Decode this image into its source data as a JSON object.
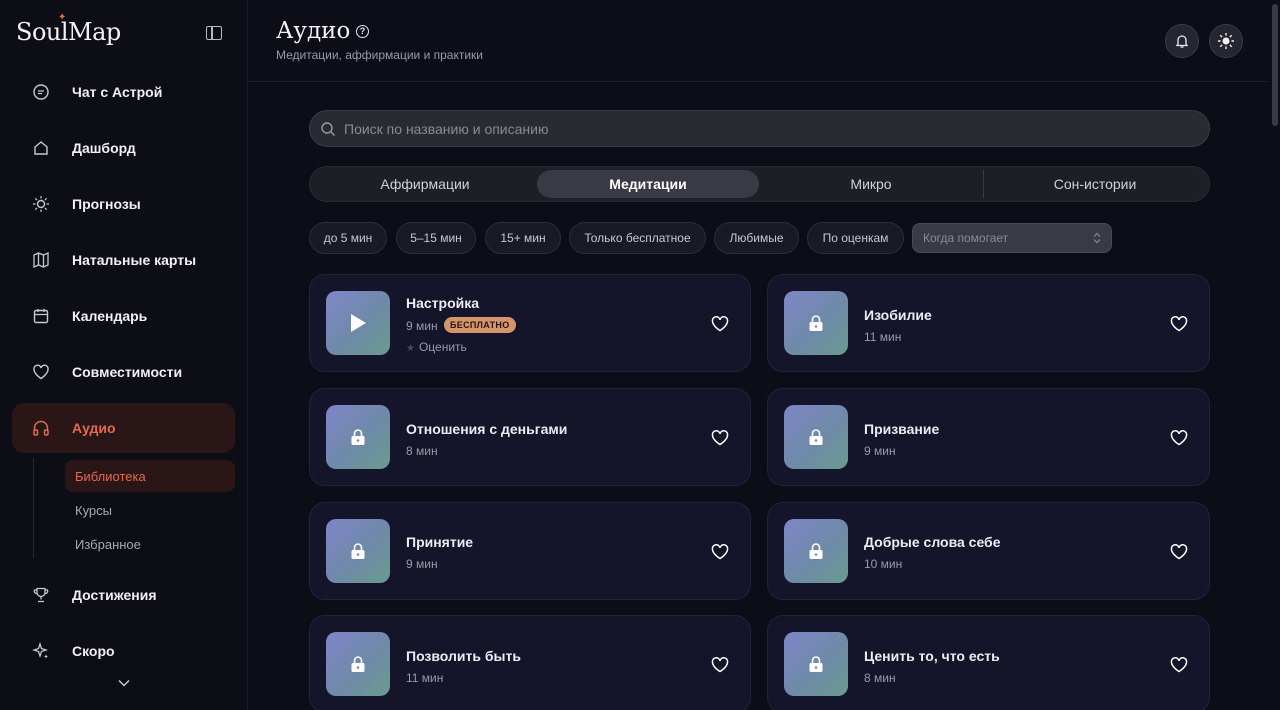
{
  "app": {
    "logo": "SoulMap"
  },
  "sidebar": {
    "items": [
      {
        "label": "Чат с Астрой",
        "icon": "chat-icon"
      },
      {
        "label": "Дашборд",
        "icon": "home-icon"
      },
      {
        "label": "Прогнозы",
        "icon": "sun-icon"
      },
      {
        "label": "Натальные карты",
        "icon": "map-icon"
      },
      {
        "label": "Календарь",
        "icon": "calendar-icon"
      },
      {
        "label": "Совместимости",
        "icon": "heart-icon"
      },
      {
        "label": "Аудио",
        "icon": "headphones-icon",
        "active": true
      },
      {
        "label": "Достижения",
        "icon": "trophy-icon"
      },
      {
        "label": "Скоро",
        "icon": "sparkle-icon"
      }
    ],
    "audio_sub": [
      {
        "label": "Библиотека",
        "active": true
      },
      {
        "label": "Курсы"
      },
      {
        "label": "Избранное"
      }
    ]
  },
  "header": {
    "title": "Аудио",
    "subtitle": "Медитации, аффирмации и практики"
  },
  "search": {
    "placeholder": "Поиск по названию и описанию"
  },
  "tabs": [
    {
      "label": "Аффирмации"
    },
    {
      "label": "Медитации",
      "active": true
    },
    {
      "label": "Микро"
    },
    {
      "label": "Сон-истории"
    }
  ],
  "filters": [
    {
      "label": "до 5 мин"
    },
    {
      "label": "5–15 мин"
    },
    {
      "label": "15+ мин"
    },
    {
      "label": "Только бесплатное"
    },
    {
      "label": "Любимые"
    },
    {
      "label": "По оценкам"
    }
  ],
  "when_select": {
    "placeholder": "Когда помогает"
  },
  "cards": [
    {
      "title": "Настройка",
      "duration": "9 мин",
      "badge": "БЕСПЛАТНО",
      "rate": "Оценить",
      "locked": false
    },
    {
      "title": "Изобилие",
      "duration": "11 мин",
      "locked": true
    },
    {
      "title": "Отношения с деньгами",
      "duration": "8 мин",
      "locked": true
    },
    {
      "title": "Призвание",
      "duration": "9 мин",
      "locked": true
    },
    {
      "title": "Принятие",
      "duration": "9 мин",
      "locked": true
    },
    {
      "title": "Добрые слова себе",
      "duration": "10 мин",
      "locked": true
    },
    {
      "title": "Позволить быть",
      "duration": "11 мин",
      "locked": true
    },
    {
      "title": "Ценить то, что есть",
      "duration": "8 мин",
      "locked": true
    }
  ],
  "colors": {
    "accent": "#e36a4f",
    "badge": "#d4956a",
    "card_bg": "#14142a"
  }
}
